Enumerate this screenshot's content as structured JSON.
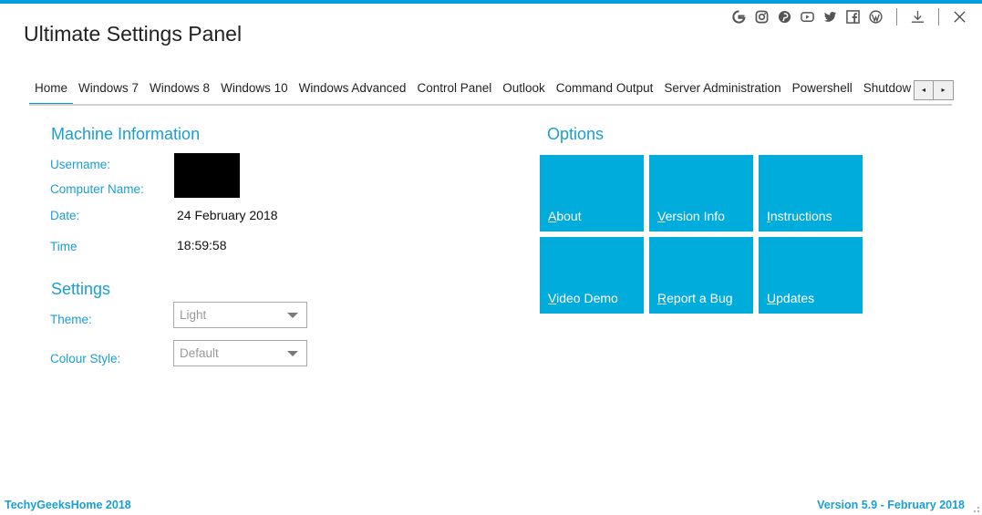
{
  "app": {
    "title": "Ultimate Settings Panel",
    "accent_color": "#009fd9",
    "tile_color": "#00acdc"
  },
  "toolbar": {
    "icons": [
      "google-icon",
      "instagram-icon",
      "pinterest-icon",
      "youtube-icon",
      "twitter-icon",
      "facebook-icon",
      "wordpress-icon",
      "download-icon",
      "close-icon"
    ]
  },
  "tabs": {
    "items": [
      "Home",
      "Windows 7",
      "Windows 8",
      "Windows 10",
      "Windows Advanced",
      "Control Panel",
      "Outlook",
      "Command Output",
      "Server Administration",
      "Powershell",
      "Shutdown Options"
    ],
    "active": "Home",
    "scroll_left": "◂",
    "scroll_right": "▸"
  },
  "machine_info": {
    "title": "Machine Information",
    "username_label": "Username:",
    "computer_name_label": "Computer Name:",
    "date_label": "Date:",
    "date_value": "24 February 2018",
    "time_label": "Time",
    "time_value": "18:59:58"
  },
  "settings": {
    "title": "Settings",
    "theme_label": "Theme:",
    "theme_value": "Light",
    "colour_style_label": "Colour Style:",
    "colour_style_value": "Default"
  },
  "options": {
    "title": "Options",
    "tiles": [
      "About",
      "Version Info",
      "Instructions",
      "Video Demo",
      "Report a Bug",
      "Updates"
    ]
  },
  "footer": {
    "left": "TechyGeeksHome 2018",
    "right": "Version 5.9 - February 2018"
  }
}
